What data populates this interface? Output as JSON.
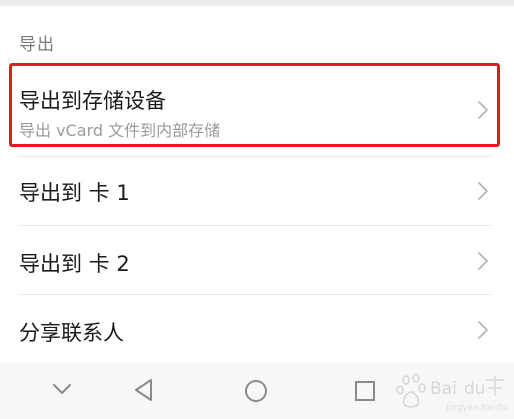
{
  "section": {
    "title": "导出"
  },
  "items": [
    {
      "title": "导出到存储设备",
      "subtitle": "导出 vCard 文件到内部存储"
    },
    {
      "title": "导出到 卡 1"
    },
    {
      "title": "导出到 卡 2"
    },
    {
      "title": "分享联系人"
    }
  ],
  "icons": {
    "chevron": "chevron-right-icon",
    "nav_down": "chevron-down-icon",
    "nav_back": "triangle-back-icon",
    "nav_home": "circle-home-icon",
    "nav_recent": "square-recent-icon"
  },
  "colors": {
    "highlight": "#e5191f",
    "title_text": "#1a1a1a",
    "secondary_text": "#9a9a9a",
    "header_text": "#7a7a7a"
  }
}
